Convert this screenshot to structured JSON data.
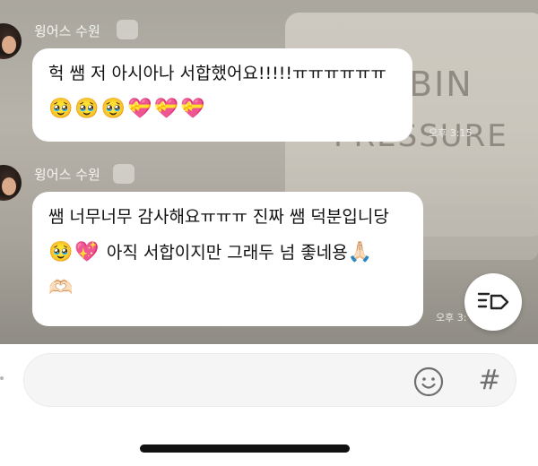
{
  "chat": {
    "background_text": [
      "BIN",
      "PRESSURE"
    ],
    "messages": [
      {
        "sender": "윙어스 수원",
        "lines": [
          "헉 쌤 저 아시아나 서합했어요!!!!!ㅠㅠㅠㅠㅠㅠ"
        ],
        "emoji_line": "🥹🥹🥹💝💝💝",
        "time": "오후 3:15"
      },
      {
        "sender": "윙어스 수원",
        "line1": "쌤 너무너무 감사해요ㅠㅠㅠ 진짜 쌤 덕분입니당",
        "line2_emoji": "🥹💖",
        "line2_text": " 아직 서합이지만 그래두 넘 좋네용",
        "line2_end": "🙏🏻",
        "line3": "🫶🏻",
        "time": "오후 3:"
      }
    ]
  },
  "composer": {
    "placeholder": "",
    "hash_label": "#"
  },
  "icons": {
    "fab": "tag-list-icon",
    "emoji": "smiley-icon"
  },
  "colors": {
    "bubble": "#ffffff",
    "icon_gray": "#6f6f6f"
  }
}
